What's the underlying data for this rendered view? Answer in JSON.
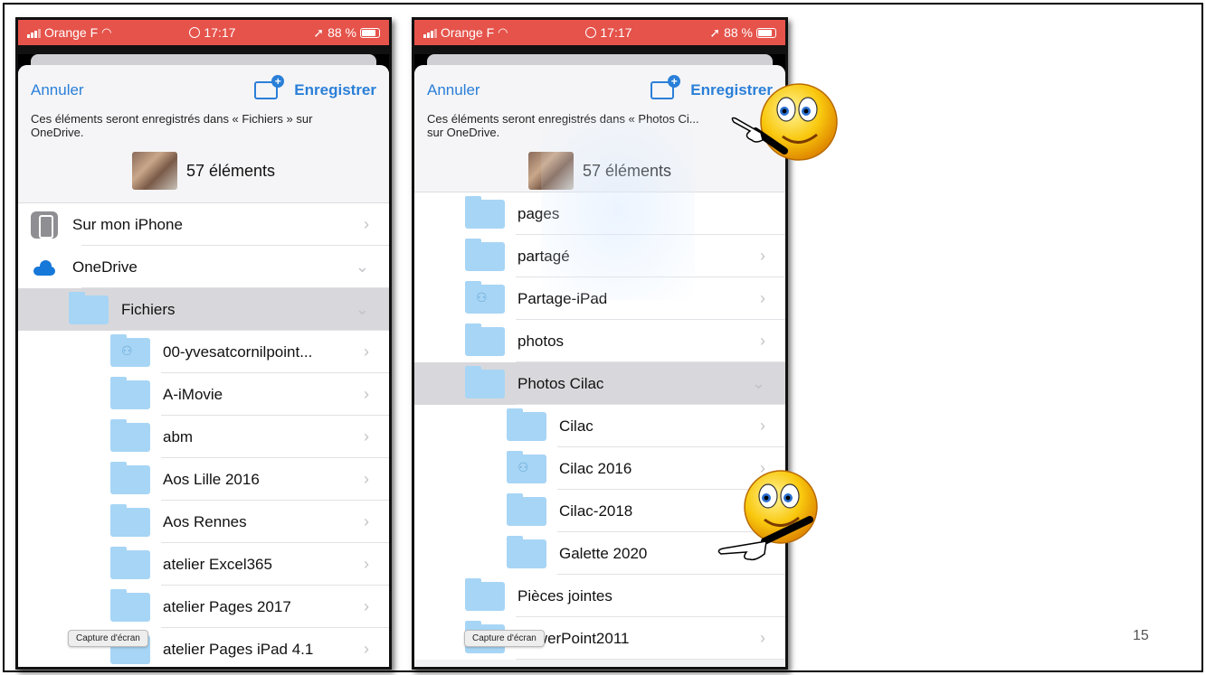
{
  "status_bar": {
    "carrier": "Orange F",
    "time": "17:17",
    "battery": "88 %"
  },
  "left_phone": {
    "cancel_label": "Annuler",
    "save_label": "Enregistrer",
    "description": "Ces éléments seront enregistrés dans « Fichiers » sur OneDrive.",
    "item_count": "57 éléments",
    "rows": [
      {
        "label": "Sur mon iPhone",
        "icon": "iphone-icon",
        "level": 0,
        "chevron": "›",
        "selected": false
      },
      {
        "label": "OneDrive",
        "icon": "onedrive-cloud-icon",
        "level": 0,
        "chevron": "⌄",
        "selected": false
      },
      {
        "label": "Fichiers",
        "icon": "folder-icon",
        "level": 1,
        "chevron": "⌄",
        "selected": true
      },
      {
        "label": "00-yvesatcornilpoint...",
        "icon": "shared-folder-icon",
        "level": 2,
        "chevron": "›",
        "selected": false
      },
      {
        "label": "A-iMovie",
        "icon": "folder-icon",
        "level": 2,
        "chevron": "›",
        "selected": false
      },
      {
        "label": "abm",
        "icon": "folder-icon",
        "level": 2,
        "chevron": "›",
        "selected": false
      },
      {
        "label": "Aos Lille 2016",
        "icon": "folder-icon",
        "level": 2,
        "chevron": "›",
        "selected": false
      },
      {
        "label": "Aos Rennes",
        "icon": "folder-icon",
        "level": 2,
        "chevron": "›",
        "selected": false
      },
      {
        "label": "atelier Excel365",
        "icon": "folder-icon",
        "level": 2,
        "chevron": "›",
        "selected": false
      },
      {
        "label": "atelier Pages 2017",
        "icon": "folder-icon",
        "level": 2,
        "chevron": "›",
        "selected": false
      },
      {
        "label": "atelier Pages iPad 4.1",
        "icon": "folder-icon",
        "level": 2,
        "chevron": "›",
        "selected": false
      }
    ],
    "capture_label": "Capture d'écran"
  },
  "right_phone": {
    "cancel_label": "Annuler",
    "save_label": "Enregistrer",
    "description": "Ces éléments seront enregistrés dans « Photos Ci... sur OneDrive.",
    "item_count": "57 éléments",
    "rows": [
      {
        "label": "pages",
        "icon": "folder-icon",
        "level": 1,
        "chevron": "",
        "selected": false
      },
      {
        "label": "partagé",
        "icon": "folder-icon",
        "level": 1,
        "chevron": "›",
        "selected": false
      },
      {
        "label": "Partage-iPad",
        "icon": "shared-folder-icon",
        "level": 1,
        "chevron": "›",
        "selected": false
      },
      {
        "label": "photos",
        "icon": "folder-icon",
        "level": 1,
        "chevron": "›",
        "selected": false
      },
      {
        "label": "Photos Cilac",
        "icon": "folder-icon",
        "level": 1,
        "chevron": "⌄",
        "selected": true
      },
      {
        "label": "Cilac",
        "icon": "folder-icon",
        "level": 2,
        "chevron": "›",
        "selected": false
      },
      {
        "label": "Cilac 2016",
        "icon": "shared-folder-icon",
        "level": 2,
        "chevron": "›",
        "selected": false
      },
      {
        "label": "Cilac-2018",
        "icon": "folder-icon",
        "level": 2,
        "chevron": "",
        "selected": false
      },
      {
        "label": "Galette 2020",
        "icon": "folder-icon",
        "level": 2,
        "chevron": "",
        "selected": false
      },
      {
        "label": "Pièces jointes",
        "icon": "folder-icon",
        "level": 1,
        "chevron": "",
        "selected": false
      },
      {
        "label": "PowerPoint2011",
        "icon": "folder-icon",
        "level": 1,
        "chevron": "›",
        "selected": false
      }
    ],
    "capture_label": "Capture d'écran"
  },
  "slide_number": "15",
  "colors": {
    "status_bar": "#e5534b",
    "accent_blue": "#2a7fd8",
    "folder": "#a7d5f5",
    "selected_row": "#d8d8dc"
  }
}
